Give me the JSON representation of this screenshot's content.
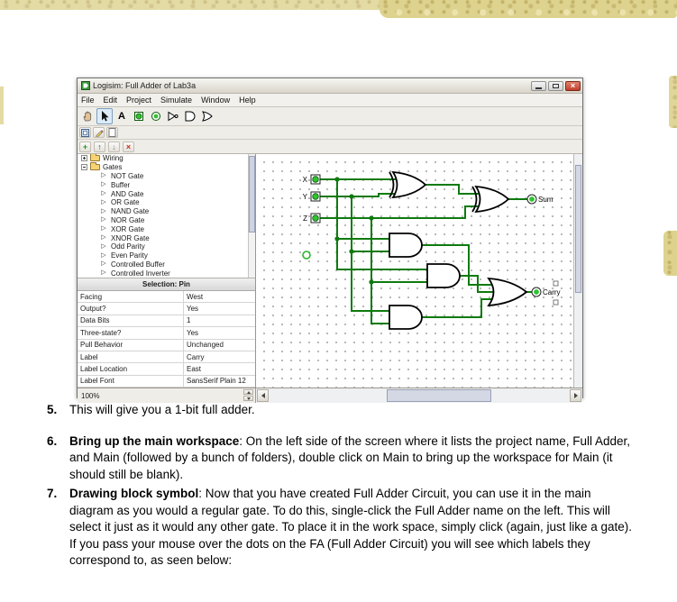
{
  "icons": {
    "gate": "▷",
    "plus": "+",
    "up": "↑",
    "down": "↓",
    "close": "×"
  },
  "window": {
    "title": "Logisim: Full Adder of Lab3a",
    "menu": [
      "File",
      "Edit",
      "Project",
      "Simulate",
      "Window",
      "Help"
    ],
    "toolbar": {
      "text_tool_label": "A"
    },
    "explorer": {
      "wiring_label": "Wiring",
      "gates_label": "Gates",
      "gates_children": [
        "NOT Gate",
        "Buffer",
        "AND Gate",
        "OR Gate",
        "NAND Gate",
        "NOR Gate",
        "XOR Gate",
        "XNOR Gate",
        "Odd Parity",
        "Even Parity",
        "Controlled Buffer",
        "Controlled Inverter"
      ]
    },
    "attributes": {
      "header": "Selection: Pin",
      "rows": [
        {
          "name": "Facing",
          "value": "West"
        },
        {
          "name": "Output?",
          "value": "Yes"
        },
        {
          "name": "Data Bits",
          "value": "1"
        },
        {
          "name": "Three-state?",
          "value": "Yes"
        },
        {
          "name": "Pull Behavior",
          "value": "Unchanged"
        },
        {
          "name": "Label",
          "value": "Carry"
        },
        {
          "name": "Label Location",
          "value": "East"
        },
        {
          "name": "Label Font",
          "value": "SansSerif Plain 12"
        }
      ]
    },
    "zoom": "100%",
    "canvas": {
      "inputs": [
        "X",
        "Y",
        "Z"
      ],
      "outputs": {
        "sum": "Sum",
        "carry": "Carry"
      }
    },
    "colors": {
      "wire": "#0e7a0e",
      "pin": "#2ec42e"
    }
  },
  "document": {
    "items": [
      {
        "number": "5.",
        "lead": "",
        "text": "This will give you a 1-bit full adder."
      },
      {
        "number": "6.",
        "lead": "Bring up the main workspace",
        "text": ": On the left side of the screen where it lists the project name, Full Adder, and Main (followed by a bunch of folders), double click on Main to bring up the workspace for Main (it should still be blank)."
      },
      {
        "number": "7.",
        "lead": "Drawing block symbol",
        "text": ": Now that you have created Full Adder Circuit, you can use it in the main diagram as you would a regular gate. To do this, single-click the Full Adder name on the left. This will select it just as it would any other gate. To place it in the work space, simply click (again, just like a gate). If you pass your mouse over the dots on the FA (Full Adder Circuit) you will see which labels they correspond to, as seen below:"
      }
    ]
  }
}
